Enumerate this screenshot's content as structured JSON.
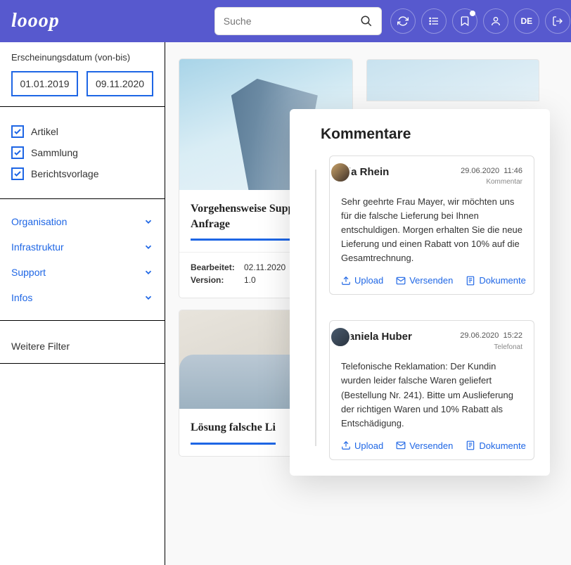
{
  "header": {
    "logo": "looop",
    "search_placeholder": "Suche",
    "lang": "DE"
  },
  "sidebar": {
    "date_label": "Erscheinungsdatum (von-bis)",
    "date_from": "01.01.2019",
    "date_to": "09.11.2020",
    "types": [
      {
        "label": "Artikel"
      },
      {
        "label": "Sammlung"
      },
      {
        "label": "Berichtsvorlage"
      }
    ],
    "categories": [
      {
        "label": "Organisation"
      },
      {
        "label": "Infrastruktur"
      },
      {
        "label": "Support"
      },
      {
        "label": "Infos"
      }
    ],
    "more_filters": "Weitere Filter"
  },
  "cards": [
    {
      "title": "Vorgehensweise Support Anfrage",
      "edited_label": "Bearbeitet:",
      "edited_value": "02.11.2020",
      "version_label": "Version:",
      "version_value": "1.0",
      "title2": "Lösung falsche Li"
    }
  ],
  "comments": {
    "title": "Kommentare",
    "items": [
      {
        "name": "Pia Rhein",
        "date": "29.06.2020",
        "time": "11:46",
        "type": "Kommentar",
        "body": "Sehr geehrte Frau Mayer, wir möchten uns für die falsche Lieferung bei Ihnen entschuldigen. Morgen erhalten Sie die neue Lieferung und einen Rabatt von 10% auf die Gesamtrechnung."
      },
      {
        "name": "Daniela Huber",
        "date": "29.06.2020",
        "time": "15:22",
        "type": "Telefonat",
        "body": "Telefonische Reklamation: Der Kundin wurden leider falsche Waren geliefert (Bestellung Nr. 241). Bitte um Auslieferung der richtigen Waren und 10% Rabatt als Entschädigung."
      }
    ],
    "actions": {
      "upload": "Upload",
      "send": "Versenden",
      "docs": "Dokumente"
    }
  }
}
